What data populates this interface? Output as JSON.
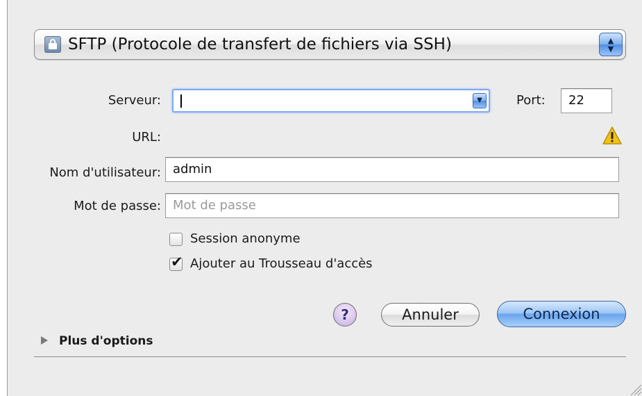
{
  "protocol_popup": {
    "selected": "SFTP (Protocole de transfert de fichiers via SSH)",
    "icon": "lock-icon"
  },
  "form": {
    "server_label": "Serveur:",
    "server_value": "",
    "port_label": "Port:",
    "port_value": "22",
    "url_label": "URL:",
    "url_value": "",
    "username_label": "Nom d'utilisateur:",
    "username_value": "admin",
    "password_label": "Mot de passe:",
    "password_placeholder": "Mot de passe"
  },
  "options": {
    "anonymous_label": "Session anonyme",
    "anonymous_checked": false,
    "keychain_label": "Ajouter au Trousseau d'accès",
    "keychain_checked": true
  },
  "buttons": {
    "help_label": "?",
    "cancel_label": "Annuler",
    "connect_label": "Connexion"
  },
  "more_options_label": "Plus d'options",
  "colors": {
    "focus_ring": "#7eaaf0",
    "default_button": "#6aa5ec",
    "warning": "#f2c313"
  }
}
